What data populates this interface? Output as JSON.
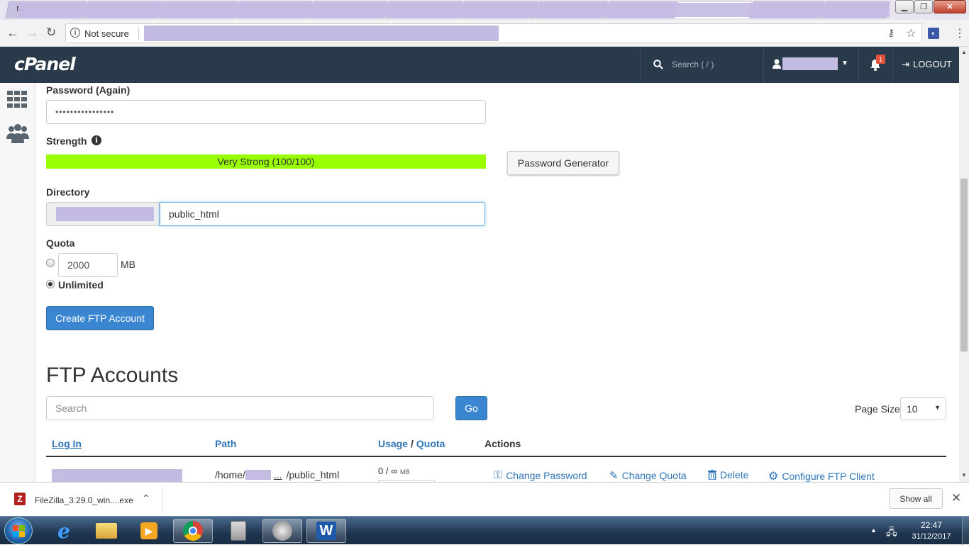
{
  "browser": {
    "security_label": "Not secure",
    "tab_first_char": "N",
    "download_filename": "FileZilla_3.29.0_win....exe",
    "download_show_all": "Show all"
  },
  "header": {
    "logo": "cPanel",
    "search_placeholder": "Search ( / )",
    "notification_count": "1",
    "logout_label": "LOGOUT"
  },
  "form": {
    "password_again_label": "Password (Again)",
    "password_again_value": "••••••••••••••••",
    "strength_label": "Strength",
    "strength_text": "Very Strong (100/100)",
    "strength_value": 100,
    "password_generator_label": "Password Generator",
    "directory_label": "Directory",
    "directory_value": "public_html",
    "quota_label": "Quota",
    "quota_value": "2000",
    "quota_unit": "MB",
    "unlimited_label": "Unlimited",
    "create_button_label": "Create FTP Account"
  },
  "accounts": {
    "heading": "FTP Accounts",
    "search_placeholder": "Search",
    "go_label": "Go",
    "page_size_label": "Page Size",
    "page_size_value": "10",
    "columns": {
      "login": "Log In",
      "path": "Path",
      "usage": "Usage",
      "slash": "/",
      "quota": "Quota",
      "actions": "Actions"
    },
    "row": {
      "path_prefix": "/home/",
      "path_ellipsis": "...",
      "path_suffix": "/public_html",
      "usage_text": "0 / ∞",
      "usage_unit": "MB",
      "change_password": "Change Password",
      "change_quota": "Change Quota",
      "delete": "Delete",
      "configure": "Configure FTP Client"
    }
  },
  "taskbar": {
    "time": "22:47",
    "date": "31/12/2017"
  },
  "colors": {
    "header_bg": "#293a4a",
    "strength_bar": "#99ff00",
    "primary_button": "#3a86d1",
    "link": "#2f76b8"
  }
}
